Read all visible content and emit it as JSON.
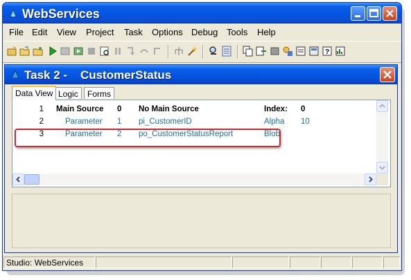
{
  "app": {
    "title": "WebServices"
  },
  "menu": [
    "File",
    "Edit",
    "View",
    "Project",
    "Task",
    "Options",
    "Debug",
    "Tools",
    "Help"
  ],
  "child_window": {
    "title": "Task 2 -    CustomerStatus"
  },
  "tabs": [
    "Data View",
    "Logic",
    "Forms"
  ],
  "active_tab": "Data View",
  "rows": [
    {
      "num": "1",
      "kind": "Main Source",
      "index": "0",
      "name": "No Main Source",
      "type": "Index:",
      "extra": "0"
    },
    {
      "num": "2",
      "kind": "Parameter",
      "index": "1",
      "name": "pi_CustomerID",
      "type": "Alpha",
      "extra": "10"
    },
    {
      "num": "3",
      "kind": "Parameter",
      "index": "2",
      "name": "po_CustomerStatusReport",
      "type": "Blob",
      "extra": ""
    }
  ],
  "status": {
    "text": "Studio: WebServices"
  },
  "colors": {
    "accent_highlight": "#cc2a2a",
    "row_text": "#1a6fa0",
    "titlebar": "#0553e0"
  }
}
